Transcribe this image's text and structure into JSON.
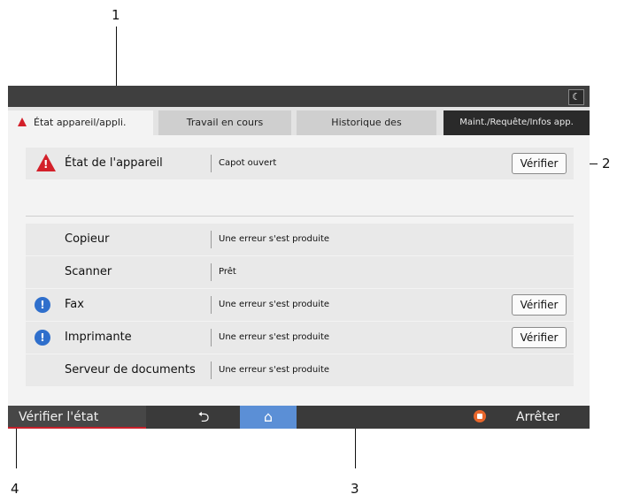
{
  "callouts": {
    "c1": "1",
    "c2": "2",
    "c3": "3",
    "c4": "4"
  },
  "topbar": {
    "night_icon": "moon-icon",
    "night_glyph": "☾"
  },
  "tabs": [
    {
      "label": "État appareil/appli.",
      "icon": "warning-icon"
    },
    {
      "label": "Travail en cours"
    },
    {
      "label": "Historique des"
    },
    {
      "label": "Maint./Requête/Infos app."
    }
  ],
  "device": {
    "label": "État de l'appareil",
    "status": "Capot ouvert",
    "button": "Vérifier"
  },
  "functions": [
    {
      "name": "Copieur",
      "status": "Une erreur s'est produite"
    },
    {
      "name": "Scanner",
      "status": "Prêt"
    },
    {
      "name": "Fax",
      "status": "Une erreur s'est produite",
      "icon": "info-icon",
      "glyph": "!",
      "button": "Vérifier"
    },
    {
      "name": "Imprimante",
      "status": "Une erreur s'est produite",
      "icon": "info-icon",
      "glyph": "!",
      "button": "Vérifier"
    },
    {
      "name": "Serveur de documents",
      "status": "Une erreur s'est produite"
    }
  ],
  "bottom": {
    "check_status": "Vérifier l'état",
    "back_glyph": "⮌",
    "home_glyph": "⌂",
    "stop": "Arrêter"
  },
  "colors": {
    "warning": "#d3202a",
    "info": "#2f6fcc",
    "home": "#5b8fd6",
    "stop": "#e8662b"
  }
}
